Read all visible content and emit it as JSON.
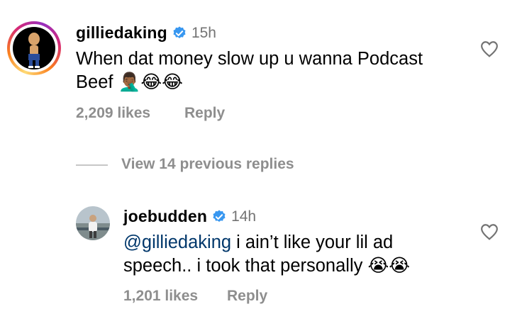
{
  "comment": {
    "username": "gilliedaking",
    "time": "15h",
    "text_line1": "When dat money slow up u wanna Podcast",
    "text_line2": "Beef",
    "emojis": [
      "🤦🏾‍♂️",
      "😂",
      "😂"
    ],
    "likes": "2,209 likes",
    "reply_label": "Reply",
    "verified": true
  },
  "thread": {
    "view_replies_label": "View 14 previous replies"
  },
  "reply": {
    "username": "joebudden",
    "time": "14h",
    "mention": "@gilliedaking",
    "text_line1_rest": " i ain’t like your lil ad",
    "text_line2": "speech.. i took that personally",
    "emojis": [
      "😭",
      "😭"
    ],
    "likes": "1,201 likes",
    "reply_label": "Reply",
    "verified": true
  },
  "colors": {
    "verified_blue": "#3897f0",
    "secondary_text": "#8e8e8e",
    "mention": "#00376b"
  }
}
